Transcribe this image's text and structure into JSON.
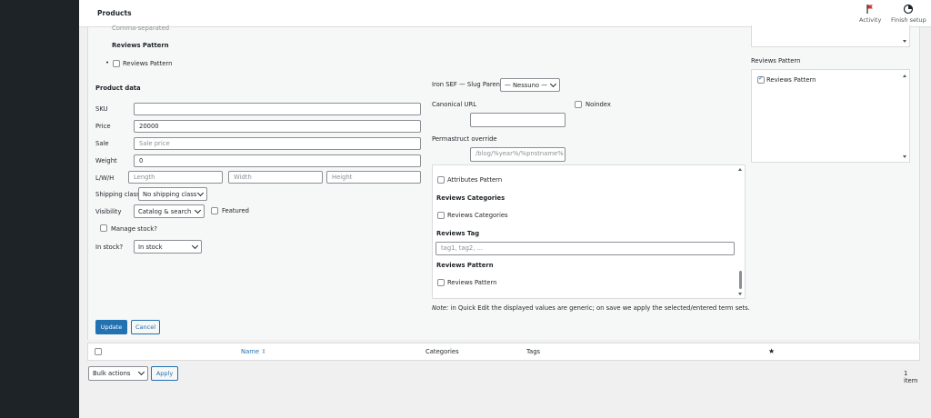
{
  "topbar": {
    "title": "Products",
    "activity_label": "Activity",
    "finish_setup_label": "Finish setup"
  },
  "left": {
    "comma_separated": "Comma-separated",
    "reviews_pattern_heading": "Reviews Pattern",
    "reviews_pattern_checkbox": "Reviews Pattern",
    "product_data_heading": "Product data",
    "sku_label": "SKU",
    "sku_value": "",
    "price_label": "Price",
    "price_value": "20000",
    "sale_label": "Sale",
    "sale_placeholder": "Sale price",
    "weight_label": "Weight",
    "weight_value": "0",
    "lwh_label": "L/W/H",
    "length_placeholder": "Length",
    "width_placeholder": "Width",
    "height_placeholder": "Height",
    "shipping_class_label": "Shipping class",
    "shipping_class_value": "No shipping class",
    "visibility_label": "Visibility",
    "visibility_value": "Catalog & search",
    "featured_label": "Featured",
    "manage_stock_label": "Manage stock?",
    "in_stock_label": "In stock?",
    "in_stock_value": "In stock"
  },
  "middle": {
    "slug_parent_label": "Iron SEF — Slug Parent",
    "slug_parent_value": "— Nessuno —",
    "canonical_url_label": "Canonical URL",
    "canonical_url_value": "",
    "noindex_label": "Noindex",
    "permastruct_label": "Permastruct override",
    "permastruct_placeholder": "/blog/%year%/%pnstname%",
    "attributes_pattern_label": "Attributes Pattern",
    "reviews_categories_heading": "Reviews Categories",
    "reviews_categories_label": "Reviews Categories",
    "reviews_tag_heading": "Reviews Tag",
    "reviews_tag_placeholder": "tag1, tag2, ...",
    "reviews_pattern_heading": "Reviews Pattern",
    "reviews_pattern_label": "Reviews Pattern",
    "note_prefix": "Note:",
    "note_text": " in Quick Edit the displayed values are generic; on save we apply the selected/entered term sets."
  },
  "right": {
    "reviews_pattern_heading": "Reviews Pattern",
    "reviews_pattern_item": "Reviews Pattern"
  },
  "actions": {
    "update_label": "Update",
    "cancel_label": "Cancel"
  },
  "table": {
    "col_name": "Name",
    "col_categories": "Categories",
    "col_tags": "Tags",
    "featured_star": "★"
  },
  "footer": {
    "bulk_actions_value": "Bulk actions",
    "apply_label": "Apply",
    "item_count": "1 item"
  },
  "colors": {
    "accent": "#2271b1",
    "primary_button": "#2271b1",
    "admin_bar": "#1d2327"
  }
}
